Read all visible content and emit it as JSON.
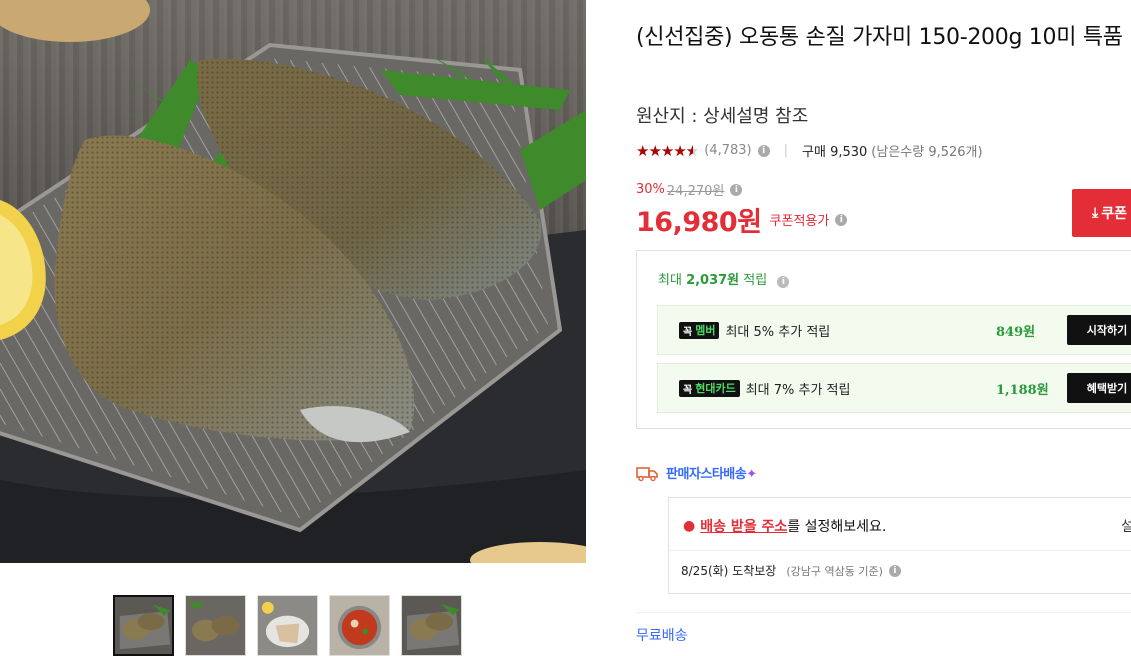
{
  "product": {
    "title": "(신선집중) 오동통 손질 가자미 150-200g 10미 특품",
    "origin": "원산지 : 상세설명 참조",
    "rating": 4.5,
    "review_count": "(4,783)",
    "purchase_label": "구매 9,530",
    "remaining_label": "(남은수량 9,526개)"
  },
  "pricing": {
    "discount_rate": "30%",
    "original_price": "24,270원",
    "sale_price": "16,980원",
    "coupon_note": "쿠폰적용가",
    "coupon_button": "쿠폰"
  },
  "points": {
    "prefix": "최대 ",
    "max_points": "2,037원",
    "suffix": " 적립",
    "benefits": [
      {
        "tag_k": "꼭",
        "tag_label": "멤버",
        "text": "최대 5% 추가 적립",
        "amount": "849원",
        "button": "시작하기"
      },
      {
        "tag_k": "꼭",
        "tag_label": "현대카드",
        "text": "최대 7% 추가 적립",
        "amount": "1,188원",
        "button": "혜택받기"
      }
    ]
  },
  "delivery": {
    "badge": "판매자스타배송",
    "badge_sparkle": "✦",
    "address_link": "배송 받을 주소",
    "address_rest": "를 설정해보세요.",
    "setting_label": "설",
    "arrival": "8/25(화) 도착보장",
    "arrival_location": "(강남구 역삼동 기준)",
    "free_shipping": "무료배송"
  },
  "icons": {
    "info": "info-circle-icon",
    "pin": "location-pin-icon",
    "truck": "truck-icon",
    "star": "star-icon",
    "download": "download-arrow-icon"
  },
  "colors": {
    "accent_red": "#e32d37",
    "green": "#2a9a3b",
    "blue": "#346aff",
    "star": "#ae0000"
  }
}
